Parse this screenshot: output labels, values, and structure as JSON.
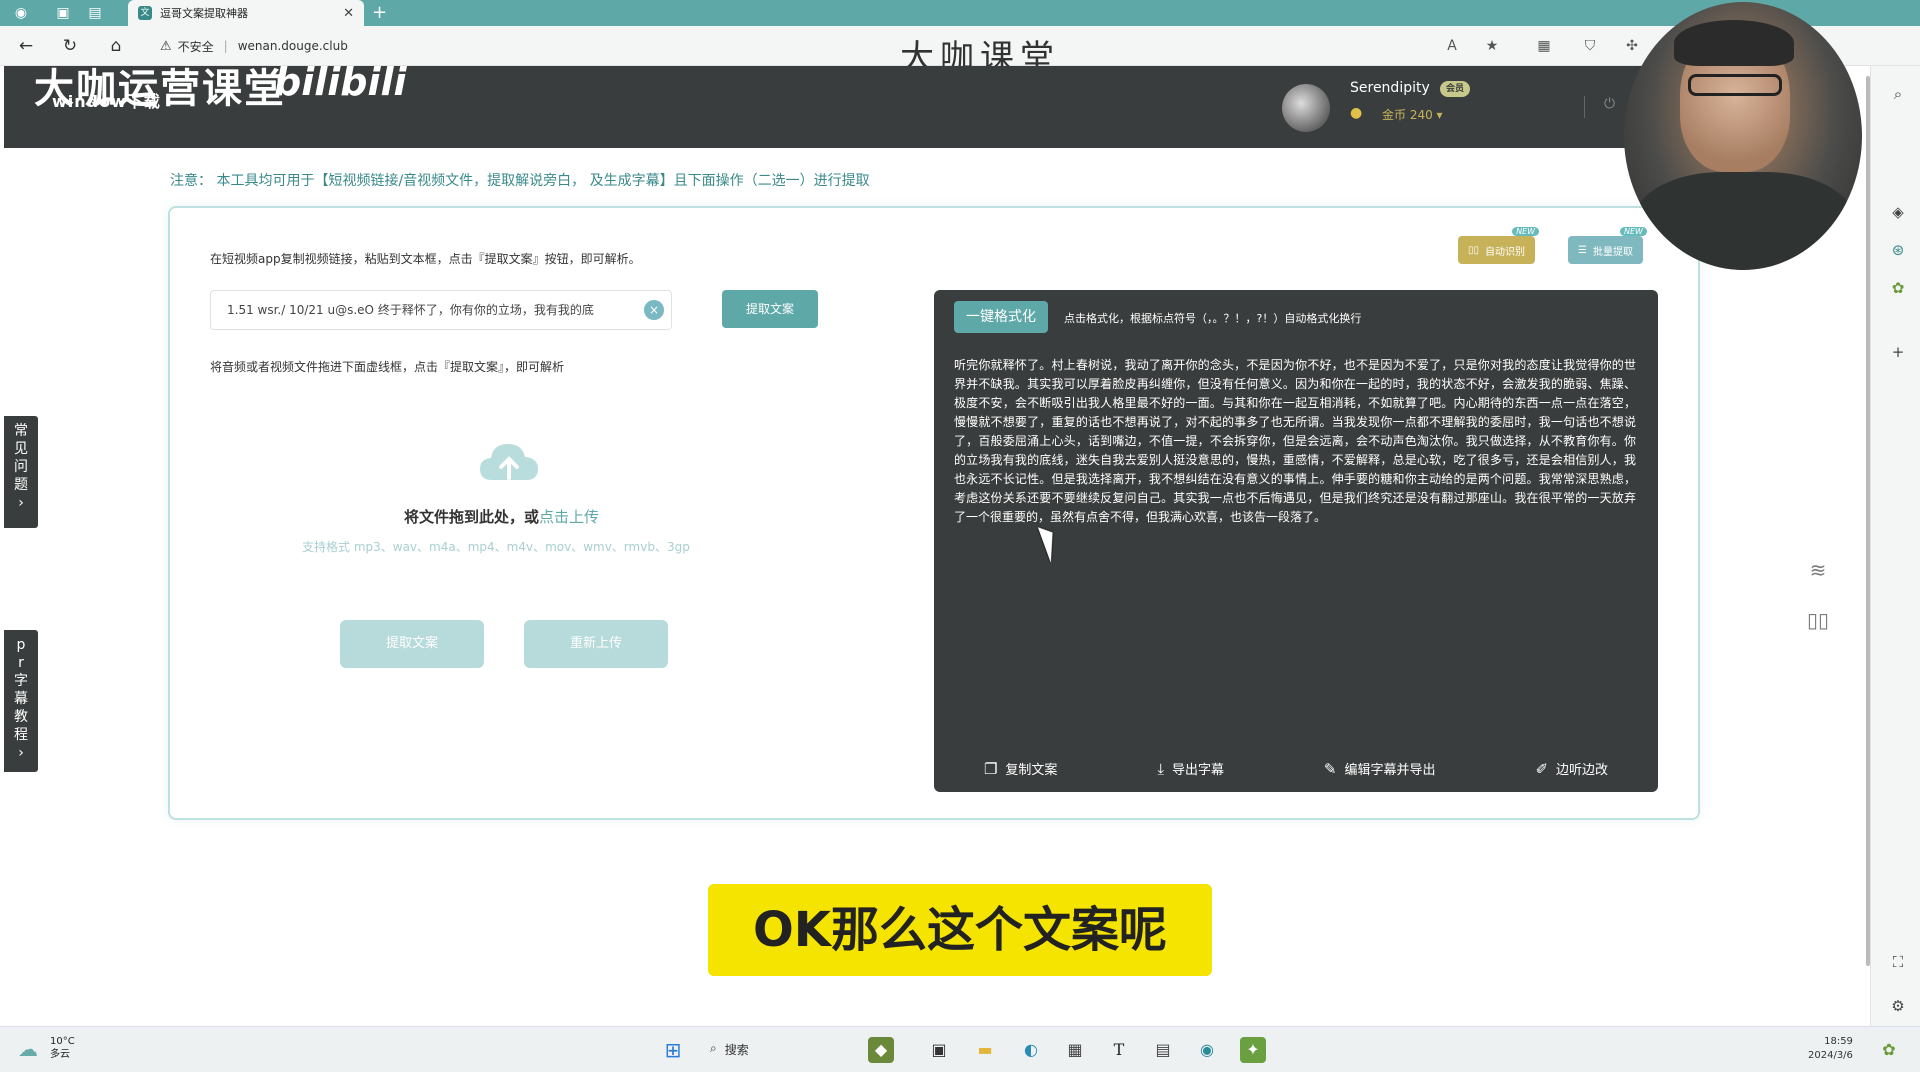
{
  "browser": {
    "tab_title": "逗哥文案提取神器",
    "new_tab": "+",
    "security": "不安全",
    "url": "wenan.dougе.club",
    "watermark": "大咖课堂"
  },
  "site": {
    "logo_main": "大咖运营课堂",
    "logo_bili": "bilibili",
    "logo_sub": "window下载",
    "user_name": "Serendipity",
    "vip_badge": "会员",
    "coins": "金币 240 ▾"
  },
  "notice": "注意： 本工具均可用于【短视频链接/音视频文件，提取解说旁白， 及生成字幕】且下面操作（二选一）进行提取",
  "features": {
    "auto_label": "自动识别",
    "batch_label": "批量提取",
    "new_tag": "NEW"
  },
  "link_section": {
    "instruction": "在短视频app复制视频链接，粘贴到文本框，点击『提取文案』按钮，即可解析。",
    "input_value": "1.51 wsr./ 10/21 u@s.eO 终于释怀了，你有你的立场，我有我的底",
    "clear_icon": "×",
    "extract_button": "提取文案"
  },
  "file_section": {
    "instruction": "将音频或者视频文件拖进下面虚线框，点击『提取文案』，即可解析",
    "drop_text": "将文件拖到此处，或",
    "drop_link": "点击上传",
    "formats": "支持格式 mp3、wav、m4a、mp4、m4v、mov、wmv、rmvb、3gp",
    "extract_button": "提取文案",
    "reupload_button": "重新上传"
  },
  "output": {
    "format_button": "一键格式化",
    "format_hint": "点击格式化，根据标点符号（，。？！，?！）自动格式化换行",
    "text": "听完你就释怀了。村上春树说，我动了离开你的念头，不是因为你不好，也不是因为不爱了，只是你对我的态度让我觉得你的世界并不缺我。其实我可以厚着脸皮再纠缠你，但没有任何意义。因为和你在一起的时，我的状态不好，会激发我的脆弱、焦躁、极度不安，会不断吸引出我人格里最不好的一面。与其和你在一起互相消耗，不如就算了吧。内心期待的东西一点一点在落空，慢慢就不想要了，重复的话也不想再说了，对不起的事多了也无所谓。当我发现你一点都不理解我的委屈时，我一句话也不想说了，百般委屈涌上心头，话到嘴边，不值一提，不会拆穿你，但是会远离，会不动声色淘汰你。我只做选择，从不教育你有。你的立场我有我的底线，迷失自我去爱别人挺没意思的，慢热，重感情，不爱解释，总是心软，吃了很多亏，还是会相信别人，我也永远不长记性。但是我选择离开，我不想纠结在没有意义的事情上。伸手要的糖和你主动给的是两个问题。我常常深思熟虑，考虑这份关系还要不要继续反复问自己。其实我一点也不后悔遇见，但是我们终究还是没有翻过那座山。我在很平常的一天放弃了一个很重要的，虽然有点舍不得，但我满心欢喜，也该告一段落了。",
    "copy": "复制文案",
    "export": "导出字幕",
    "edit_export": "编辑字幕并导出",
    "listen_edit": "边听边改"
  },
  "side_tabs": {
    "faq": "常见问题",
    "pr_tutorial": "pr字幕教程"
  },
  "subtitle": "OK那么这个文案呢",
  "taskbar": {
    "temperature": "10°C",
    "weather": "多云",
    "search": "搜索",
    "time": "18:59",
    "date": "2024/3/6"
  }
}
